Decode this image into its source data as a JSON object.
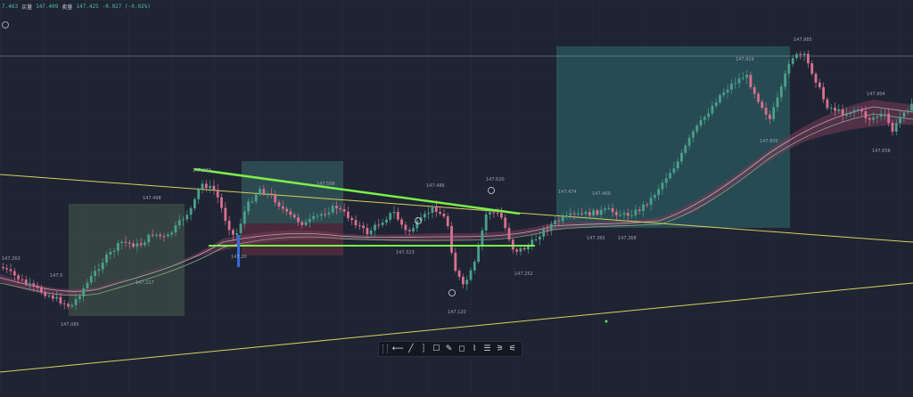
{
  "topbar": {
    "items": [
      "7.463",
      "买量",
      "147.409",
      "卖量",
      "147.425",
      "-0.027 (-0.02%)"
    ]
  },
  "toolbar": {
    "tools": [
      {
        "name": "horizontal-line-tool",
        "glyph": "⟵"
      },
      {
        "name": "trend-line-tool",
        "glyph": "╱"
      },
      {
        "name": "vertical-line-tool",
        "glyph": "┆"
      },
      {
        "name": "rectangle-tool",
        "glyph": "☐"
      },
      {
        "name": "brush-tool",
        "glyph": "✎"
      },
      {
        "name": "callout-tool",
        "glyph": "◻"
      },
      {
        "name": "path-tool",
        "glyph": "⌇"
      },
      {
        "name": "fib-retracement-tool",
        "glyph": "☰"
      },
      {
        "name": "long-position-tool",
        "glyph": "⚞"
      },
      {
        "name": "short-position-tool",
        "glyph": "⚟"
      }
    ]
  },
  "chart_data": {
    "type": "candlestick",
    "price_labels": [
      {
        "text": "147.263"
      },
      {
        "text": "147.5"
      },
      {
        "text": "147.085"
      },
      {
        "text": "147.498"
      },
      {
        "text": "147.217"
      },
      {
        "text": "147.582"
      },
      {
        "text": "147.20"
      },
      {
        "text": "147.598"
      },
      {
        "text": "147.323"
      },
      {
        "text": "147.486"
      },
      {
        "text": "147.620"
      },
      {
        "text": "147.120"
      },
      {
        "text": "147.252"
      },
      {
        "text": "147.474"
      },
      {
        "text": "147.469"
      },
      {
        "text": "147.365"
      },
      {
        "text": "147.368"
      },
      {
        "text": "147.919"
      },
      {
        "text": "147.985"
      },
      {
        "text": "147.800"
      },
      {
        "text": "147.904"
      },
      {
        "text": "147.658"
      }
    ],
    "colors": {
      "up": "#4aa08c",
      "down": "#d8708f",
      "trendline": "#7cf04a",
      "yellow_lines": "#d8d060",
      "background": "#1f2433"
    }
  }
}
